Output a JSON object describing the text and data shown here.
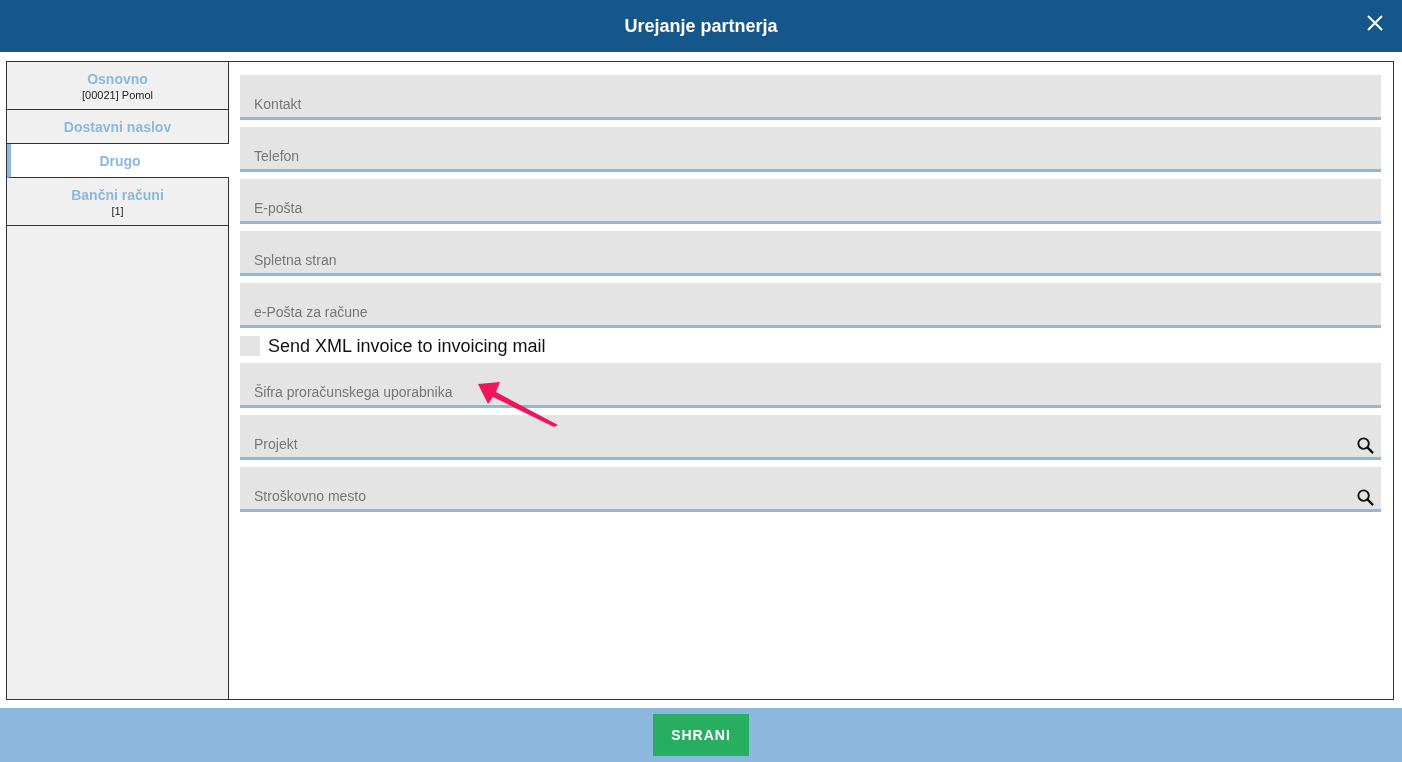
{
  "window": {
    "title": "Urejanje partnerja"
  },
  "tabs": [
    {
      "label": "Osnovno",
      "sub": "[00021] Pomol",
      "selected": false
    },
    {
      "label": "Dostavni naslov",
      "selected": false
    },
    {
      "label": "Drugo",
      "selected": true
    },
    {
      "label": "Bančni računi",
      "sub": "[1]",
      "selected": false
    }
  ],
  "fields": [
    {
      "kind": "text",
      "placeholder": "Kontakt"
    },
    {
      "kind": "text",
      "placeholder": "Telefon"
    },
    {
      "kind": "text",
      "placeholder": "E-pošta"
    },
    {
      "kind": "text",
      "placeholder": "Spletna stran"
    },
    {
      "kind": "text",
      "placeholder": "e-Pošta za račune"
    },
    {
      "kind": "checkbox",
      "label": "Send XML invoice to invoicing mail",
      "checked": false
    },
    {
      "kind": "text",
      "placeholder": "Šifra proračunskega uporabnika"
    },
    {
      "kind": "lookup",
      "placeholder": "Projekt"
    },
    {
      "kind": "lookup",
      "placeholder": "Stroškovno mesto"
    }
  ],
  "buttons": [
    "SHRANI"
  ]
}
